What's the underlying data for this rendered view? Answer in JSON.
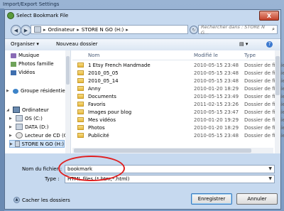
{
  "background_window": {
    "title": "Import/Export Settings"
  },
  "dialog": {
    "title": "Select Bookmark File",
    "close_label": "X"
  },
  "nav": {
    "back_glyph": "◀",
    "forward_glyph": "▶",
    "breadcrumb": [
      "Ordinateur",
      "STORE N GO (H:)"
    ],
    "search_placeholder": "Rechercher dans : STORE N G..."
  },
  "toolbar": {
    "organize": "Organiser ▾",
    "new_folder": "Nouveau dossier"
  },
  "sidebar": {
    "items": [
      {
        "label": "Musique",
        "icon": "music-icon"
      },
      {
        "label": "Photos famille",
        "icon": "pictures-icon"
      },
      {
        "label": "Vidéos",
        "icon": "videos-icon"
      },
      {
        "label": "Groupe résidentiel",
        "icon": "homegroup-icon"
      },
      {
        "label": "Ordinateur",
        "icon": "computer-icon"
      },
      {
        "label": "OS (C:)",
        "icon": "drive-icon"
      },
      {
        "label": "DATA (D:)",
        "icon": "drive-icon"
      },
      {
        "label": "Lecteur de CD (G",
        "icon": "cd-icon"
      },
      {
        "label": "STORE N GO (H:)",
        "icon": "usb-drive-icon"
      }
    ]
  },
  "file_list": {
    "columns": [
      "Nom",
      "Modifié le",
      "Type"
    ],
    "rows": [
      {
        "name": "1 Etsy French Handmade",
        "date": "2010-05-15 23:48",
        "type": "Dossier de fichiers"
      },
      {
        "name": "2010_05_05",
        "date": "2010-05-15 23:48",
        "type": "Dossier de fichiers"
      },
      {
        "name": "2010_05_14",
        "date": "2010-05-15 23:48",
        "type": "Dossier de fichiers"
      },
      {
        "name": "Anny",
        "date": "2010-01-20 18:29",
        "type": "Dossier de fichiers"
      },
      {
        "name": "Documents",
        "date": "2010-05-15 23:49",
        "type": "Dossier de fichiers"
      },
      {
        "name": "Favoris",
        "date": "2011-02-15 23:26",
        "type": "Dossier de fichiers"
      },
      {
        "name": "Images pour blog",
        "date": "2010-05-15 23:47",
        "type": "Dossier de fichiers"
      },
      {
        "name": "Mes vidéos",
        "date": "2010-01-20 19:29",
        "type": "Dossier de fichiers"
      },
      {
        "name": "Photos",
        "date": "2010-01-20 18:29",
        "type": "Dossier de fichiers"
      },
      {
        "name": "Publicité",
        "date": "2010-05-15 23:48",
        "type": "Dossier de fichiers"
      }
    ]
  },
  "form": {
    "filename_label": "Nom du fichier :",
    "filename_value": "bookmark",
    "type_label": "Type :",
    "type_value": "HTML files (*.htm;*.html)"
  },
  "footer": {
    "hide_folders": "Cacher les dossiers",
    "save": "Enregistrer",
    "cancel": "Annuler"
  }
}
